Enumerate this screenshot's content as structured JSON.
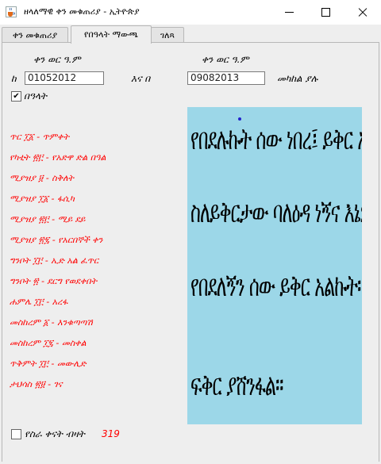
{
  "window": {
    "title": "ዘላለማዊ ቀን መቁጠሪያ - ኢትዮጵያ"
  },
  "tabs": [
    {
      "label": "ቀን መቁጠሪያ",
      "active": false
    },
    {
      "label": "የበዓላት ማውጫ",
      "active": true
    },
    {
      "label": "ገለጻ",
      "active": false
    }
  ],
  "range": {
    "from_header": "ቀን ወር ዓ.ም",
    "to_header": "ቀን ወር ዓ.ም",
    "from_label": "ከ",
    "from_value": "01052012",
    "and_label": "እና በ",
    "to_value": "09082013",
    "between_label": "መካከል ያሉ",
    "holidays_checkbox_label": "በዓላት",
    "holidays_checked": true
  },
  "holidays": [
    "ጥር ፲፩ - ጥምቀት",
    "የካቲት ፳፫ - የአድዋ ድል በዓል",
    "ሚያዝያ ፱ - ስቅለት",
    "ሚያዝያ ፲፩ - ፋሲካ",
    "ሚያዝያ ፳፫ - ሚይ ደይ",
    "ሚያዝያ ፳፯ - የአርበኞች ቀን",
    "ግንቦት ፲፫ - ኢድ አል ፈጥር",
    "ግንቦት ፳ - ደርግ የወደቀበት",
    "ሐምሌ ፲፫ - አረፋ",
    "መስከረም ፩ - እንቁጣጣሽ",
    "መስከረም ፲፯ - መስቀል",
    "ጥቅምት ፲፫ - መውሊድ",
    "ታህሳስ ፳፱ - ገና"
  ],
  "quote": {
    "lines": [
      "የበደሉኩት ሰው ነበረ፤ ይቅር አለኝ።",
      "ስለይቅርታው ባለዕዳ ነኝና እኔም",
      "የበደለኝን ሰው ይቅር አልኩት።",
      "ፍቅር ያሸንፋል።"
    ]
  },
  "workdays": {
    "checkbox_label": "የስራ ቀናት ብዛት",
    "checked": false,
    "count": "319"
  },
  "colors": {
    "holiday_text": "#ff0000",
    "quote_background": "#9cd7e8"
  },
  "icons": {
    "app": "java-cup-icon",
    "minimize": "minimize-icon",
    "maximize": "maximize-icon",
    "close": "close-icon"
  }
}
